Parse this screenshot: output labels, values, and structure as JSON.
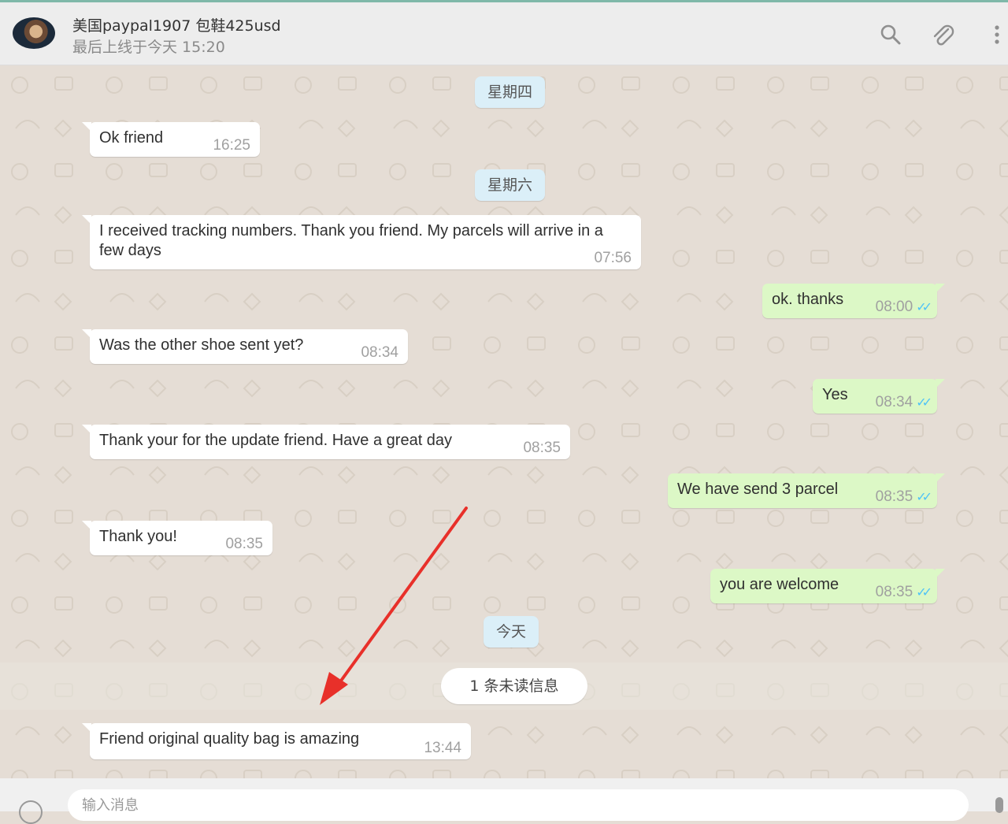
{
  "header": {
    "contact_name": "美国paypal1907 包鞋425usd",
    "status": "最后上线于今天 15:20",
    "icons": [
      "search-icon",
      "attach-icon",
      "menu-icon"
    ]
  },
  "colors": {
    "incoming_bubble": "#ffffff",
    "outgoing_bubble": "#dcf8c6",
    "day_label_bg": "#dbeff8",
    "tick_color": "#4fc3f7",
    "arrow": "#e8302a"
  },
  "chat": {
    "day_labels": [
      "星期四",
      "星期六",
      "今天"
    ],
    "unread_notice": "1 条未读信息",
    "messages": [
      {
        "direction": "in",
        "text": "Ok friend",
        "time": "16:25"
      },
      {
        "direction": "in",
        "text": "I received tracking numbers. Thank you friend. My parcels will arrive in a few days",
        "time": "07:56"
      },
      {
        "direction": "out",
        "text": "ok. thanks",
        "time": "08:00",
        "read_tick": "✓✓"
      },
      {
        "direction": "in",
        "text": "Was the other shoe sent yet?",
        "time": "08:34"
      },
      {
        "direction": "out",
        "text": "Yes",
        "time": "08:34",
        "read_tick": "✓✓"
      },
      {
        "direction": "in",
        "text": "Thank your for the update friend. Have a great day",
        "time": "08:35"
      },
      {
        "direction": "out",
        "text": "We have send 3 parcel",
        "time": "08:35",
        "read_tick": "✓✓"
      },
      {
        "direction": "in",
        "text": "Thank you!",
        "time": "08:35"
      },
      {
        "direction": "out",
        "text": "you are welcome",
        "time": "08:35",
        "read_tick": "✓✓"
      },
      {
        "direction": "in",
        "text": "Friend original quality bag is amazing",
        "time": "13:44"
      }
    ]
  },
  "composer": {
    "placeholder": "输入消息",
    "icons": [
      "emoji-icon",
      "microphone-icon"
    ]
  }
}
